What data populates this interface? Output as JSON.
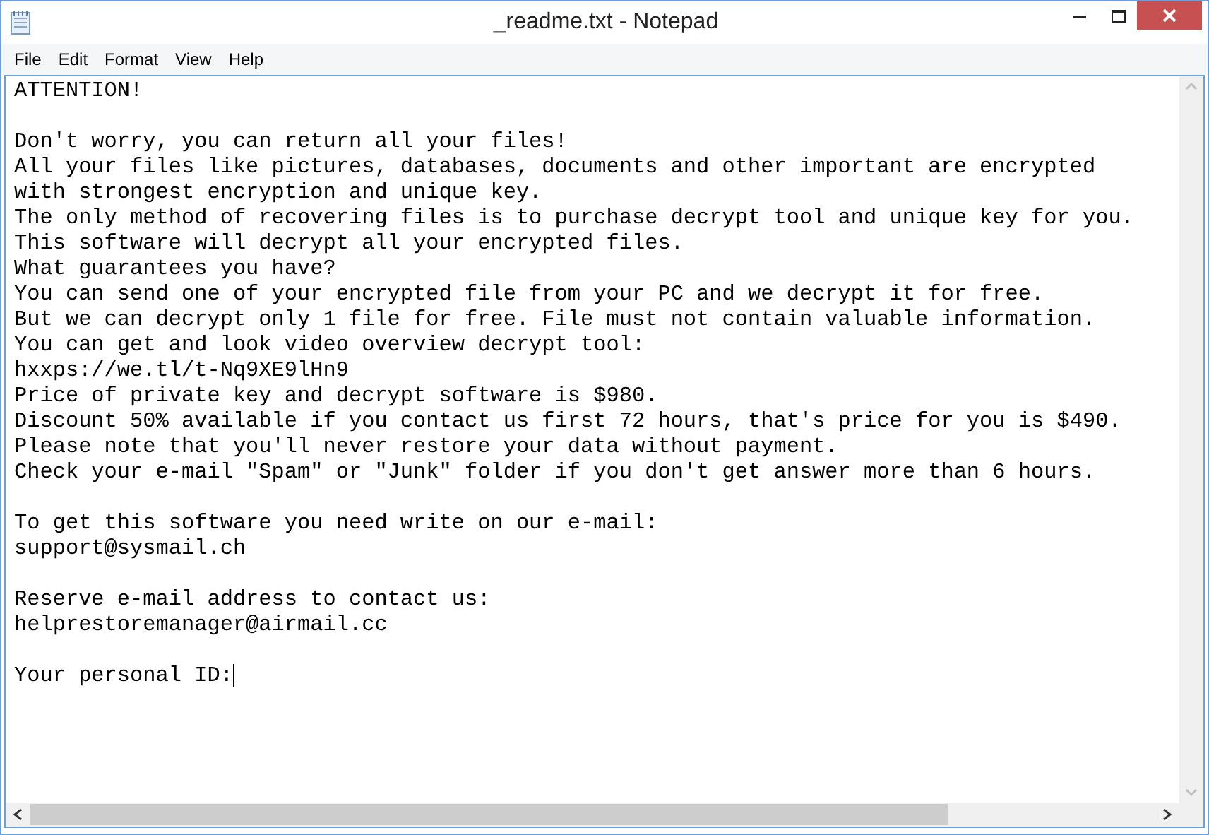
{
  "window": {
    "title": "_readme.txt - Notepad"
  },
  "menu": [
    "File",
    "Edit",
    "Format",
    "View",
    "Help"
  ],
  "document": {
    "lines": [
      {
        "kind": "text",
        "text": "ATTENTION!"
      },
      {
        "kind": "blank"
      },
      {
        "kind": "text",
        "text": "Don't worry, you can return all your files!"
      },
      {
        "kind": "text",
        "text": "All your files like pictures, databases, documents and other important are encrypted"
      },
      {
        "kind": "text",
        "text": "with strongest encryption and unique key."
      },
      {
        "kind": "text",
        "text": "The only method of recovering files is to purchase decrypt tool and unique key for you."
      },
      {
        "kind": "text",
        "text": "This software will decrypt all your encrypted files."
      },
      {
        "kind": "text",
        "text": "What guarantees you have?"
      },
      {
        "kind": "text",
        "text": "You can send one of your encrypted file from your PC and we decrypt it for free."
      },
      {
        "kind": "text",
        "text": "But we can decrypt only 1 file for free. File must not contain valuable information."
      },
      {
        "kind": "text",
        "text": "You can get and look video overview decrypt tool:"
      },
      {
        "kind": "text",
        "text": "hxxps://we.tl/t-Nq9XE9lHn9"
      },
      {
        "kind": "text",
        "text": "Price of private key and decrypt software is $980."
      },
      {
        "kind": "text",
        "text": "Discount 50% available if you contact us first 72 hours, that's price for you is $490."
      },
      {
        "kind": "text",
        "text": "Please note that you'll never restore your data without payment."
      },
      {
        "kind": "text",
        "text": "Check your e-mail \"Spam\" or \"Junk\" folder if you don't get answer more than 6 hours."
      },
      {
        "kind": "blank"
      },
      {
        "kind": "text",
        "text": "To get this software you need write on our e-mail:"
      },
      {
        "kind": "text",
        "text": "support@sysmail.ch"
      },
      {
        "kind": "blank"
      },
      {
        "kind": "text",
        "text": "Reserve e-mail address to contact us:"
      },
      {
        "kind": "text",
        "text": "helprestoremanager@airmail.cc"
      },
      {
        "kind": "blank"
      },
      {
        "kind": "text",
        "text": "Your personal ID:",
        "caret": true
      }
    ]
  }
}
